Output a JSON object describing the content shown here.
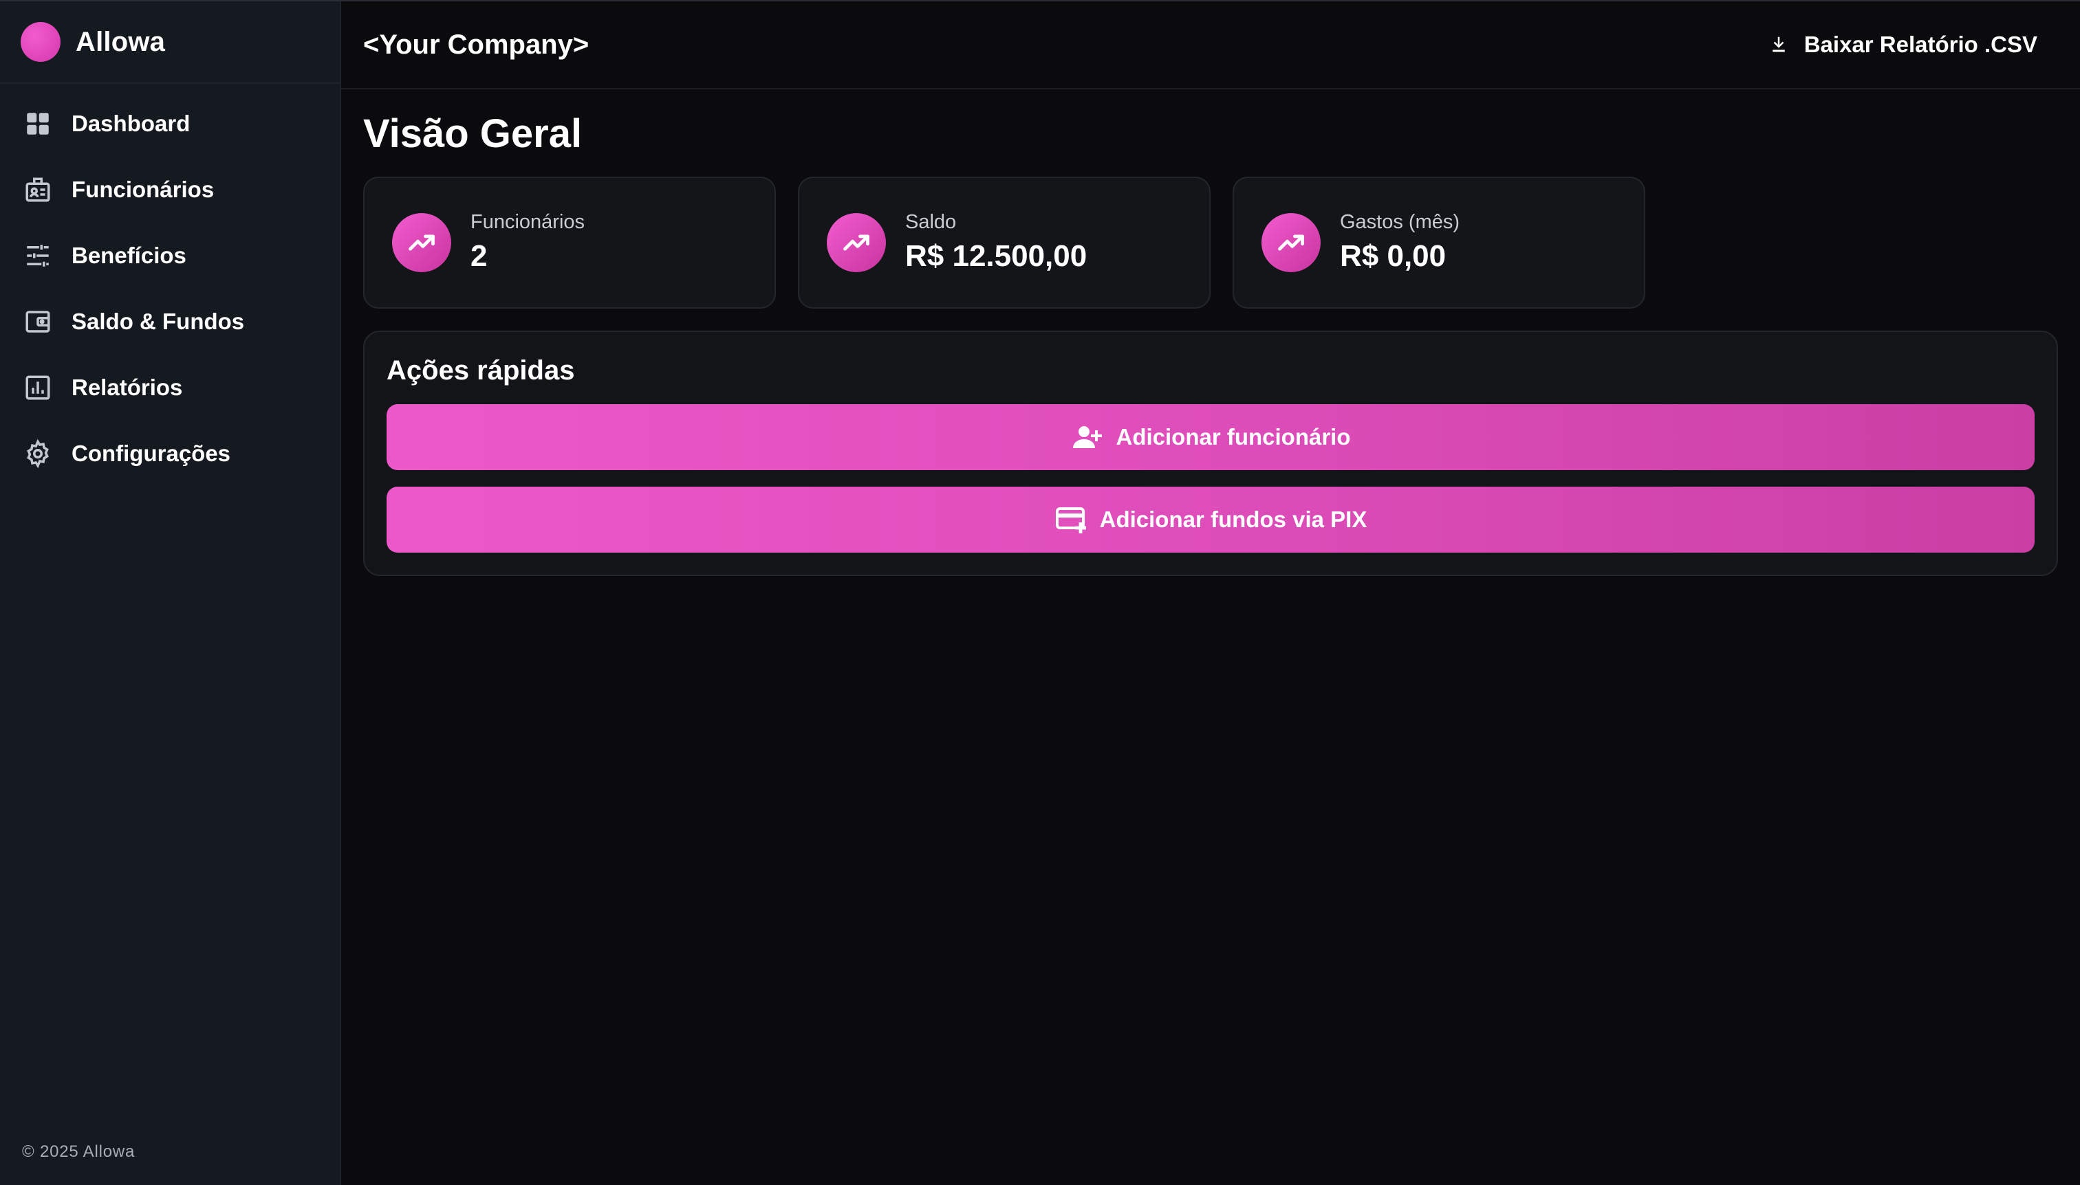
{
  "brand": {
    "name": "Allowa",
    "accent": "#e34cbf"
  },
  "sidebar": {
    "items": [
      {
        "label": "Dashboard",
        "icon": "dashboard-grid-icon"
      },
      {
        "label": "Funcionários",
        "icon": "badge-icon"
      },
      {
        "label": "Benefícios",
        "icon": "sliders-icon"
      },
      {
        "label": "Saldo & Fundos",
        "icon": "wallet-icon"
      },
      {
        "label": "Relatórios",
        "icon": "bar-chart-icon"
      },
      {
        "label": "Configurações",
        "icon": "gear-icon"
      }
    ],
    "footer": "© 2025 Allowa"
  },
  "header": {
    "company": "<Your Company>",
    "download_label": "Baixar Relatório .CSV",
    "download_icon": "download-icon"
  },
  "main": {
    "title": "Visão Geral",
    "stats": [
      {
        "label": "Funcionários",
        "value": "2",
        "icon": "trending-up-icon"
      },
      {
        "label": "Saldo",
        "value": "R$ 12.500,00",
        "icon": "trending-up-icon"
      },
      {
        "label": "Gastos (mês)",
        "value": "R$ 0,00",
        "icon": "trending-up-icon"
      }
    ],
    "quick_actions": {
      "title": "Ações rápidas",
      "buttons": [
        {
          "label": "Adicionar funcionário",
          "icon": "person-add-icon"
        },
        {
          "label": "Adicionar fundos via PIX",
          "icon": "card-add-icon"
        }
      ]
    }
  }
}
